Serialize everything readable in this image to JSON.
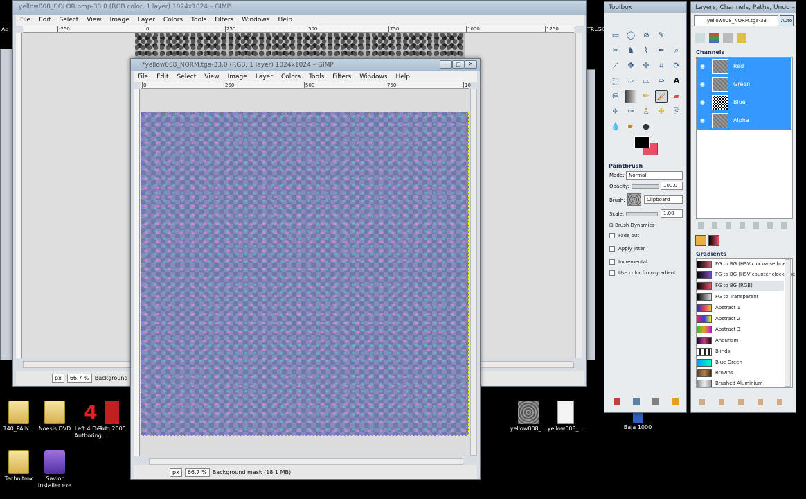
{
  "gimp_main": {
    "title": "yellow008_COLOR.bmp-33.0 (RGB color, 1 layer) 1024x1024 – GIMP",
    "menus": [
      "File",
      "Edit",
      "Select",
      "View",
      "Image",
      "Layer",
      "Colors",
      "Tools",
      "Filters",
      "Windows",
      "Help"
    ],
    "ruler_ticks": [
      "-250",
      "0",
      "250",
      "500",
      "750",
      "1000",
      "1250"
    ],
    "status_unit": "px",
    "status_zoom": "66.7 %",
    "status_text": "Background"
  },
  "gimp_norm": {
    "title": "*yellow008_NORM.tga-33.0 (RGB, 1 layer) 1024x1024 – GIMP",
    "menus": [
      "File",
      "Edit",
      "Select",
      "View",
      "Image",
      "Layer",
      "Colors",
      "Tools",
      "Filters",
      "Windows",
      "Help"
    ],
    "ruler_ticks": [
      "0",
      "250",
      "500",
      "750",
      "10"
    ],
    "status_unit": "px",
    "status_zoom": "66.7 %",
    "status_text": "Background mask (18.1 MB)"
  },
  "toolbox": {
    "title": "Toolbox",
    "options_title": "Paintbrush",
    "mode_label": "Mode:",
    "mode_value": "Normal",
    "opacity_label": "Opacity:",
    "opacity_value": "100.0",
    "brush_label": "Brush:",
    "brush_value": "Clipboard",
    "scale_label": "Scale:",
    "scale_value": "1.00",
    "brush_dynamics": "Brush Dynamics",
    "fade_out": "Fade out",
    "apply_jitter": "Apply Jitter",
    "incremental": "Incremental",
    "use_color_gradient": "Use color from gradient",
    "colors": {
      "fg": "#000000",
      "bg": "#e8506a"
    }
  },
  "layers_dock": {
    "title": "Layers, Channels, Paths, Undo – Pa...",
    "image_select": "yellow008_NORM.tga-33",
    "auto_label": "Auto",
    "channels_title": "Channels",
    "channels": [
      "Red",
      "Green",
      "Blue",
      "Alpha"
    ],
    "gradients_title": "Gradients",
    "gradients": [
      {
        "name": "FG to BG (HSV clockwise hue)",
        "color": "linear-gradient(90deg,#000,#c06070)"
      },
      {
        "name": "FG to BG (HSV counter-clockwise)",
        "color": "linear-gradient(90deg,#000,#8050c0)"
      },
      {
        "name": "FG to BG (RGB)",
        "color": "linear-gradient(90deg,#000,#e8506a)"
      },
      {
        "name": "FG to Transparent",
        "color": "linear-gradient(90deg,#000,#ddd)"
      },
      {
        "name": "Abstract 1",
        "color": "linear-gradient(90deg,#2030c0,#e04060,#f0c040)"
      },
      {
        "name": "Abstract 2",
        "color": "linear-gradient(90deg,#f02060,#3040e0,#f0f040)"
      },
      {
        "name": "Abstract 3",
        "color": "linear-gradient(90deg,#30c030,#e0a020,#c020c0)"
      },
      {
        "name": "Aneurism",
        "color": "linear-gradient(90deg,#200040,#c04080,#300010)"
      },
      {
        "name": "Blinds",
        "color": "repeating-linear-gradient(90deg,#fff 0 3px,#222 3px 6px)"
      },
      {
        "name": "Blue Green",
        "color": "linear-gradient(90deg,#00a0ff,#00ffc0)"
      },
      {
        "name": "Browns",
        "color": "linear-gradient(90deg,#6a3a10,#c08040,#5a2a00)"
      },
      {
        "name": "Brushed Aluminium",
        "color": "linear-gradient(90deg,#888,#eee,#999)"
      }
    ]
  },
  "desktop": {
    "icons": [
      {
        "label": "140_PAIN...",
        "kind": "folder"
      },
      {
        "label": "Noesis DVD",
        "kind": "folder"
      },
      {
        "label": "Left 4 Dead Authoring...",
        "kind": "app"
      },
      {
        "label": "Torq 2005",
        "kind": "app"
      },
      {
        "label": "yellow008_...",
        "kind": "image"
      },
      {
        "label": "yellow008_...",
        "kind": "file"
      },
      {
        "label": "Baja 1000",
        "kind": "app"
      },
      {
        "label": "Technitrox",
        "kind": "folder"
      },
      {
        "label": "Savior Installer.exe",
        "kind": "installer"
      }
    ],
    "left_labels": [
      "Ad",
      "TRLGC"
    ]
  }
}
